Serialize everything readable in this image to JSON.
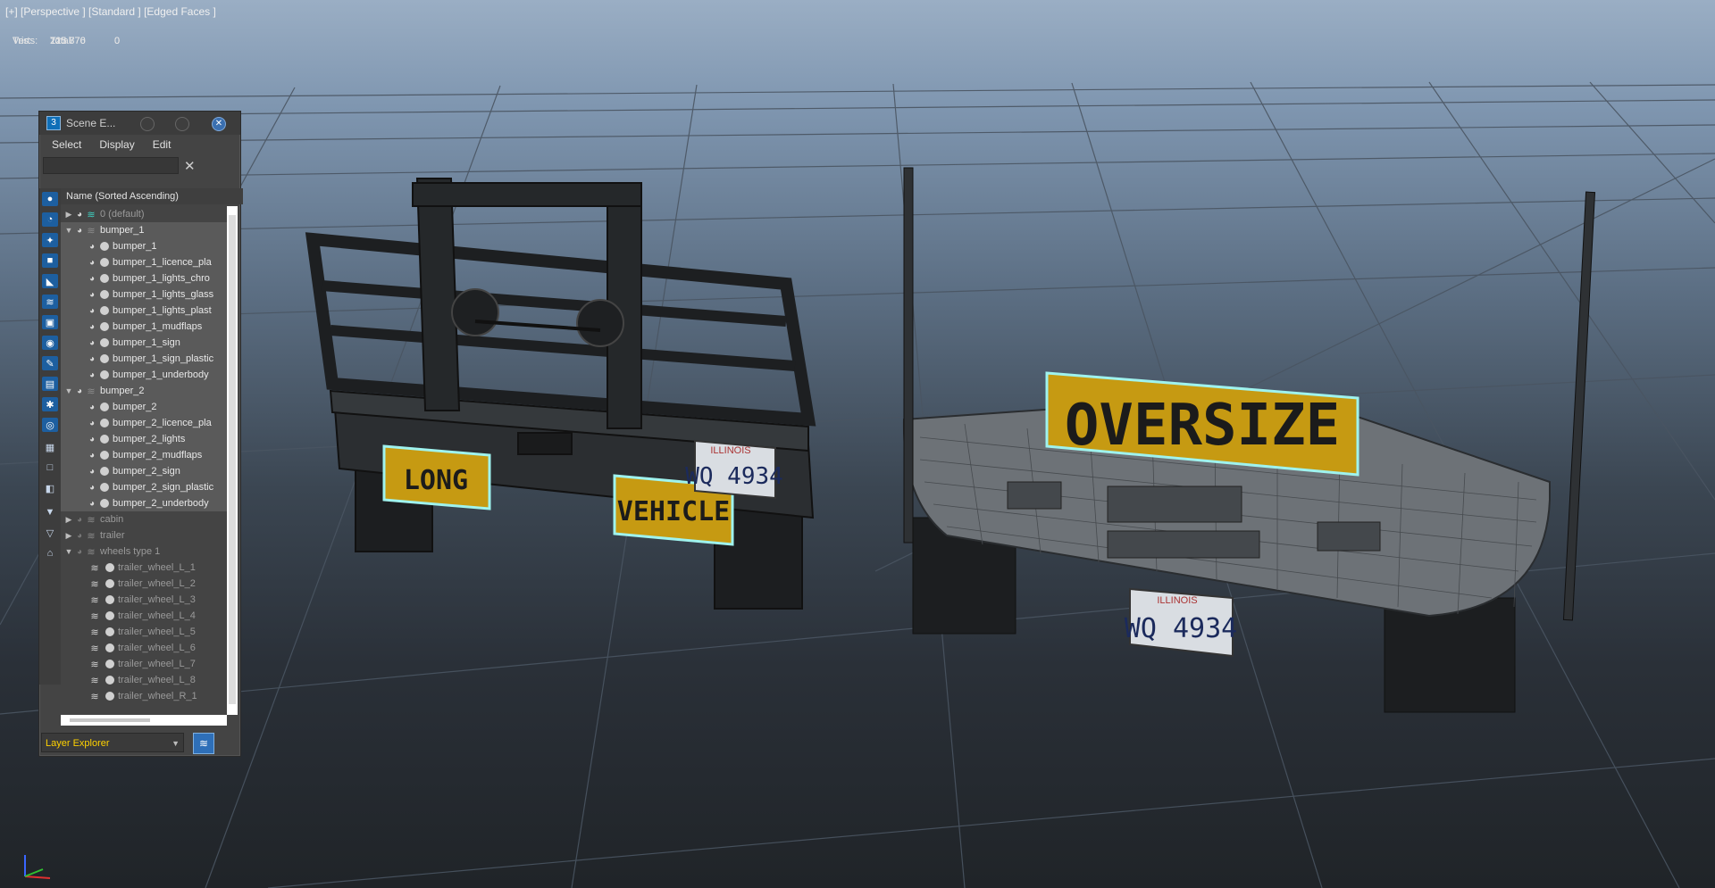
{
  "viewport": {
    "label": "[+] [Perspective ] [Standard ] [Edged Faces ]",
    "stats": {
      "header": "Total",
      "rows": [
        {
          "key": "Tris:",
          "total": "215 770",
          "selected": "0"
        },
        {
          "key": "Verts:",
          "total": "123 876",
          "selected": "0"
        }
      ]
    },
    "signs": {
      "long": "LONG",
      "vehicle": "VEHICLE",
      "oversize": "OVERSIZE",
      "plate_state": "ILLINOIS",
      "plate_number": "WQ 4934"
    },
    "colors": {
      "sign_yellow": "#c69a12",
      "selection_cyan": "#9ff3ee",
      "sky_top": "#9aaec4",
      "ground": "#2a3038"
    }
  },
  "scene_explorer": {
    "title": "Scene E...",
    "menu": [
      "Select",
      "Display",
      "Edit"
    ],
    "search_placeholder": "",
    "column_header": "Name (Sorted Ascending)",
    "rows": [
      {
        "label": "0 (default)",
        "dim": true
      },
      {
        "label": "bumper_1",
        "dim": false
      },
      {
        "label": "bumper_1",
        "dim": false
      },
      {
        "label": "bumper_1_licence_pla",
        "dim": false
      },
      {
        "label": "bumper_1_lights_chro",
        "dim": false
      },
      {
        "label": "bumper_1_lights_glass",
        "dim": false
      },
      {
        "label": "bumper_1_lights_plast",
        "dim": false
      },
      {
        "label": "bumper_1_mudflaps",
        "dim": false
      },
      {
        "label": "bumper_1_sign",
        "dim": false
      },
      {
        "label": "bumper_1_sign_plastic",
        "dim": false
      },
      {
        "label": "bumper_1_underbody",
        "dim": false
      },
      {
        "label": "bumper_2",
        "dim": false
      },
      {
        "label": "bumper_2",
        "dim": false
      },
      {
        "label": "bumper_2_licence_pla",
        "dim": false
      },
      {
        "label": "bumper_2_lights",
        "dim": false
      },
      {
        "label": "bumper_2_mudflaps",
        "dim": false
      },
      {
        "label": "bumper_2_sign",
        "dim": false
      },
      {
        "label": "bumper_2_sign_plastic",
        "dim": false
      },
      {
        "label": "bumper_2_underbody",
        "dim": false
      },
      {
        "label": "cabin",
        "dim": true
      },
      {
        "label": "trailer",
        "dim": true
      },
      {
        "label": "wheels type 1",
        "dim": true
      },
      {
        "label": "trailer_wheel_L_1",
        "dim": true
      },
      {
        "label": "trailer_wheel_L_2",
        "dim": true
      },
      {
        "label": "trailer_wheel_L_3",
        "dim": true
      },
      {
        "label": "trailer_wheel_L_4",
        "dim": true
      },
      {
        "label": "trailer_wheel_L_5",
        "dim": true
      },
      {
        "label": "trailer_wheel_L_6",
        "dim": true
      },
      {
        "label": "trailer_wheel_L_7",
        "dim": true
      },
      {
        "label": "trailer_wheel_L_8",
        "dim": true
      },
      {
        "label": "trailer_wheel_R_1",
        "dim": true
      }
    ],
    "layer_explorer_label": "Layer Explorer"
  }
}
